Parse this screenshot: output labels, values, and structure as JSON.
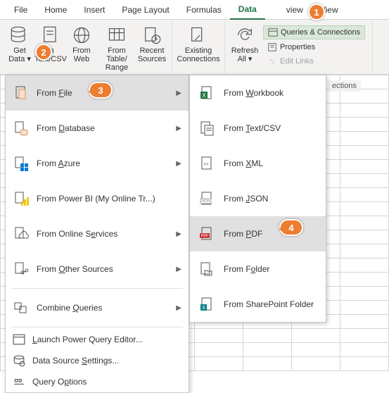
{
  "tabs": {
    "file": "File",
    "home": "Home",
    "insert": "Insert",
    "pagelayout": "Page Layout",
    "formulas": "Formulas",
    "data": "Data",
    "review": "view",
    "view": "View"
  },
  "ribbon": {
    "getdata": "Get",
    "getdata2": "Data",
    "textcsv": "m",
    "textcsv2": "Text/CSV",
    "web": "From",
    "web2": "Web",
    "table": "From Table/",
    "table2": "Range",
    "recent": "Recent",
    "recent2": "Sources",
    "existing": "Existing",
    "existing2": "Connections",
    "refresh": "Refresh",
    "refresh2": "All",
    "queries": "Queries & Connections",
    "properties": "Properties",
    "editlinks": "Edit Links",
    "connpartial": "ections"
  },
  "menu1": {
    "file": "From File",
    "db": "From Database",
    "azure": "From Azure",
    "pbi": "From Power BI (My Online Tr...)",
    "online": "From Online Services",
    "other": "From Other Sources",
    "combine": "Combine Queries",
    "launch": "Launch Power Query Editor...",
    "settings": "Data Source Settings...",
    "options": "Query Options"
  },
  "menu2": {
    "workbook": "From Workbook",
    "textcsv": "From Text/CSV",
    "xml": "From XML",
    "json": "From JSON",
    "pdf": "From PDF",
    "folder": "From Folder",
    "spfolder": "From SharePoint Folder"
  },
  "callouts": {
    "c1": "1",
    "c2": "2",
    "c3": "3",
    "c4": "4"
  }
}
